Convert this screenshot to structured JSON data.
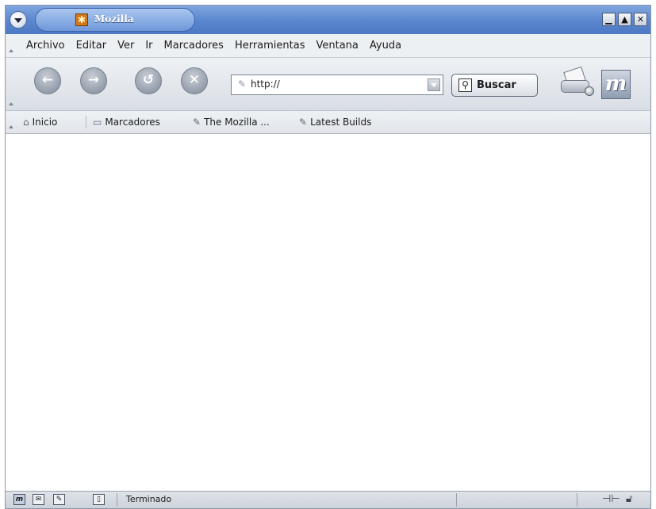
{
  "window": {
    "title": "Mozilla"
  },
  "menubar": {
    "items": [
      "Archivo",
      "Editar",
      "Ver",
      "Ir",
      "Marcadores",
      "Herramientas",
      "Ventana",
      "Ayuda"
    ]
  },
  "navbar": {
    "url_value": "http://",
    "search_label": "Buscar"
  },
  "bookmarks": {
    "home_label": "Inicio",
    "bookmarks_label": "Marcadores",
    "link1_label": "The Mozilla ...",
    "link2_label": "Latest Builds"
  },
  "status": {
    "text": "Terminado"
  },
  "icons": {
    "window_menu": "chevron-down-icon",
    "app": "mozilla-icon",
    "back": "back-arrow-icon",
    "forward": "forward-arrow-icon",
    "reload": "reload-icon",
    "stop": "stop-icon",
    "search": "magnifier-icon",
    "print": "print-icon",
    "throbber": "mozilla-logo-icon",
    "online": "connection-icon",
    "security": "lock-icon"
  },
  "colors": {
    "titlebar": "#5a86cf",
    "toolbar": "#e8ebef",
    "content": "#ffffff"
  }
}
